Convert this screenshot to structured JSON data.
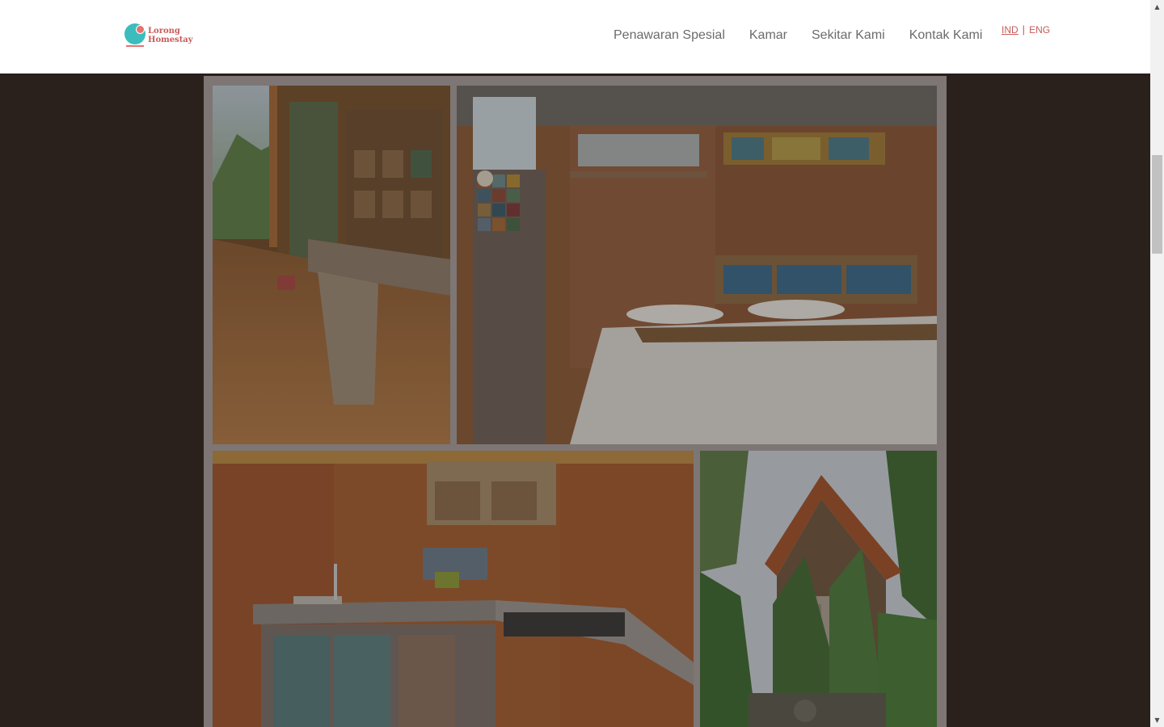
{
  "header": {
    "logo": {
      "line1": "Lorong",
      "line2": "Homestay"
    },
    "nav": [
      {
        "label": "Penawaran Spesial"
      },
      {
        "label": "Kamar"
      },
      {
        "label": "Sekitar Kami"
      },
      {
        "label": "Kontak Kami"
      }
    ],
    "lang": {
      "ind": "IND",
      "separator": "|",
      "eng": "ENG",
      "selected": "IND"
    }
  },
  "gallery": {
    "photos": [
      {
        "name": "veranda-bench-photo",
        "subject": "wooden veranda with log bench"
      },
      {
        "name": "bedroom-photo",
        "subject": "bedroom with brick wall and double bed"
      },
      {
        "name": "kitchen-photo",
        "subject": "kitchenette with sink and gas stove"
      },
      {
        "name": "house-exterior-photo",
        "subject": "wooden house exterior with garden"
      }
    ]
  },
  "colors": {
    "brand_teal": "#3cbcbd",
    "brand_coral": "#e4736c",
    "brand_text": "#c85a5a",
    "nav_text": "#6b6b6b",
    "page_background": "#2a211d"
  },
  "icons": {
    "scroll_up": "scroll-up-arrow-icon",
    "scroll_down": "scroll-down-arrow-icon"
  }
}
